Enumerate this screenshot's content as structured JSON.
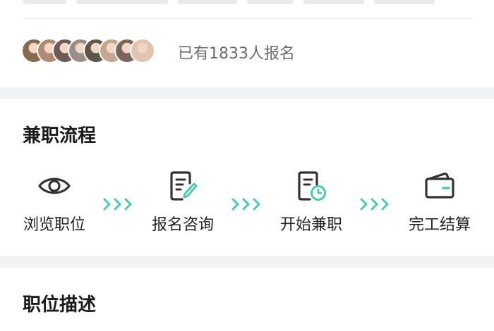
{
  "signup": {
    "count_text": "已有1833人报名",
    "avatar_colors": [
      "#8a6a4f",
      "#b08a74",
      "#6f5a55",
      "#9a8f88",
      "#5f5648",
      "#c7a690",
      "#7d6659",
      "#e2c4ae"
    ]
  },
  "flow": {
    "title": "兼职流程",
    "steps": [
      {
        "label": "浏览职位",
        "icon": "eye-icon"
      },
      {
        "label": "报名咨询",
        "icon": "edit-document-icon"
      },
      {
        "label": "开始兼职",
        "icon": "document-clock-icon"
      },
      {
        "label": "完工结算",
        "icon": "wallet-icon"
      }
    ],
    "arrow_color": "#4dc9b0"
  },
  "description": {
    "title": "职位描述"
  }
}
